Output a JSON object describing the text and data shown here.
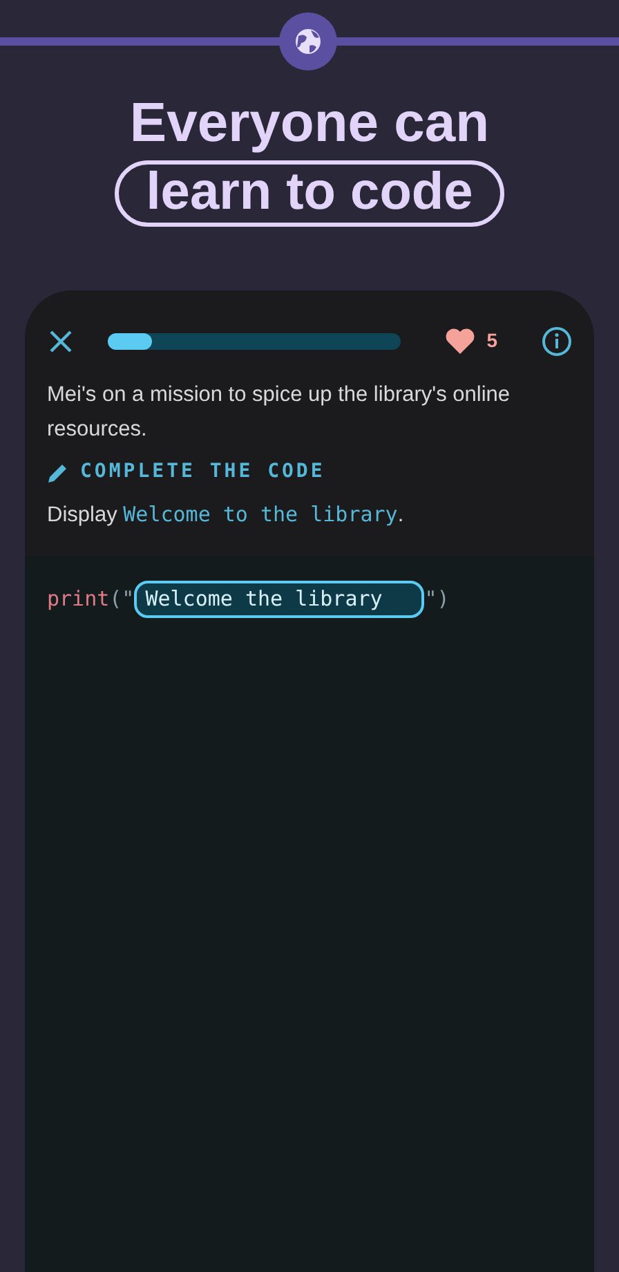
{
  "headline": {
    "line_1": "Everyone can",
    "line_2": "learn to code"
  },
  "lesson": {
    "progress": {
      "level": 0.15
    },
    "hearts": "5",
    "story": "Mei's on a mission to spice up the library's online resources.",
    "instruction_label": "COMPLETE THE CODE",
    "task": {
      "prefix": "Display",
      "code": "Welcome to the library",
      "suffix": "."
    },
    "code_line": {
      "function": "print",
      "open": "(\"",
      "answer": "Welcome the library",
      "close": "\")"
    }
  }
}
